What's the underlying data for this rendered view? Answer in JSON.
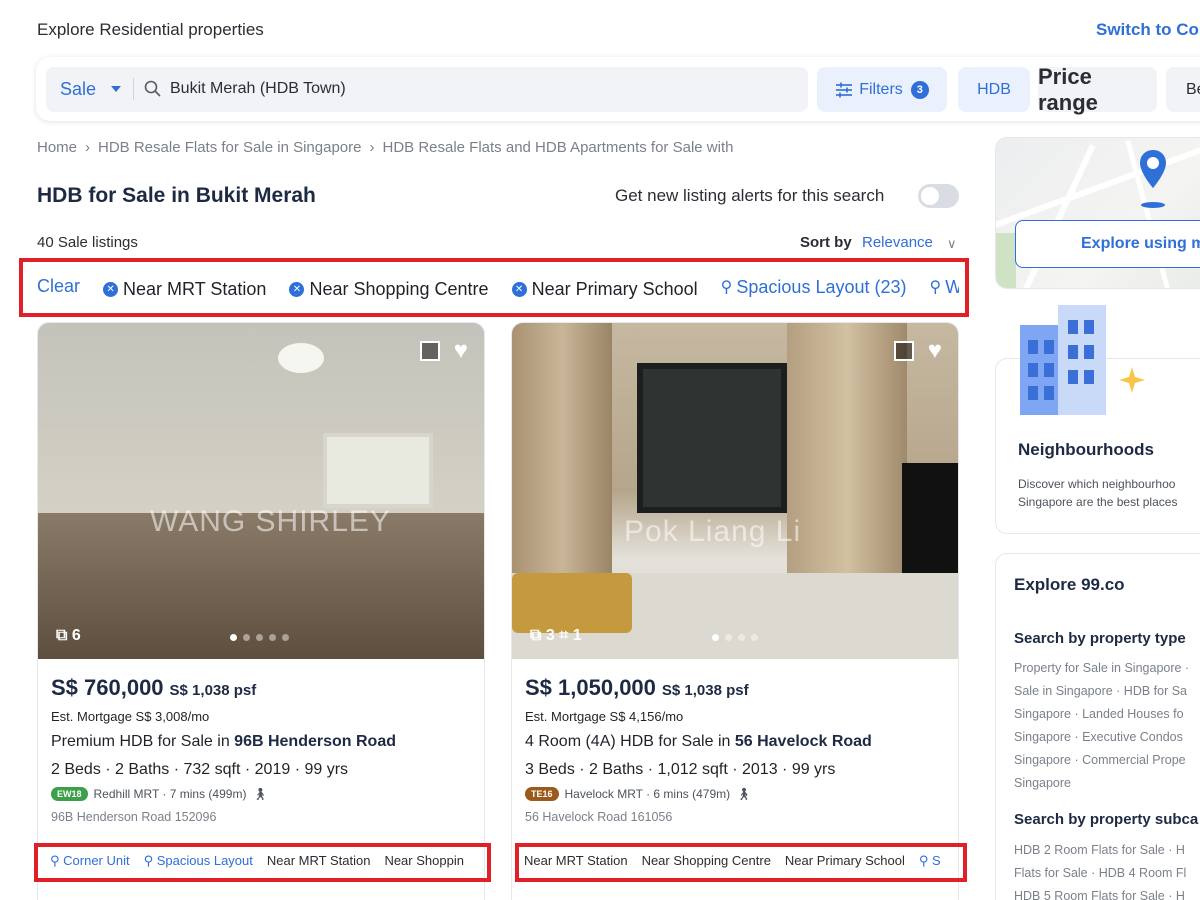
{
  "header": {
    "explore_label": "Explore Residential properties",
    "switch_label": "Switch to Co"
  },
  "search": {
    "mode": "Sale",
    "query": "Bukit Merah (HDB Town)",
    "filters_label": "Filters",
    "filters_count": "3",
    "hdb_label": "HDB",
    "price_label": "Price range",
    "beds_label": "Be"
  },
  "breadcrumb": [
    "Home",
    "HDB Resale Flats for Sale in Singapore",
    "HDB Resale Flats and HDB Apartments for Sale with"
  ],
  "page": {
    "title": "HDB for Sale in Bukit Merah",
    "alert_label": "Get new listing alerts for this search",
    "count_label": "40 Sale listings",
    "sort_label": "Sort by",
    "sort_value": "Relevance"
  },
  "chips": {
    "clear": "Clear",
    "active": [
      "Near MRT Station",
      "Near Shopping Centre",
      "Near Primary School"
    ],
    "suggested": [
      "Spacious Layout (23)",
      "We"
    ]
  },
  "listings": [
    {
      "watermark": "WANG SHIRLEY",
      "photo_count": "6",
      "price": "S$ 760,000",
      "psf": "S$ 1,038 psf",
      "mortgage": "Est. Mortgage S$ 3,008/mo",
      "title_prefix": "Premium HDB for Sale in ",
      "title_bold": "96B Henderson Road",
      "specs": "2 Beds · 2 Baths · 732 sqft · 2019 · 99 yrs",
      "mrt_code": "EW18",
      "mrt_color": "#3aa04a",
      "mrt_text": "Redhill MRT · 7 mins (499m)",
      "address": "96B Henderson Road 152096",
      "tags_link": [
        "Corner Unit",
        "Spacious Layout"
      ],
      "tags": [
        "Near MRT Station",
        "Near Shoppin"
      ]
    },
    {
      "watermark": "Pok Liang Li",
      "photo_count": "3",
      "floorplan_count": "1",
      "price": "S$ 1,050,000",
      "psf": "S$ 1,038 psf",
      "mortgage": "Est. Mortgage S$ 4,156/mo",
      "title_prefix": "4 Room (4A) HDB for Sale in ",
      "title_bold": "56 Havelock Road",
      "specs": "3 Beds · 2 Baths · 1,012 sqft · 2013 · 99 yrs",
      "mrt_code": "TE16",
      "mrt_color": "#9b5a1a",
      "mrt_text": "Havelock MRT · 6 mins (479m)",
      "address": "56 Havelock Road 161056",
      "tags": [
        "Near MRT Station",
        "Near Shopping Centre",
        "Near Primary School"
      ],
      "tags_link": [
        "S"
      ]
    }
  ],
  "sidebar": {
    "map_button": "Explore using m",
    "neighbourhoods_title": "Neighbourhoods",
    "neighbourhoods_desc_1": "Discover which neighbourhoo",
    "neighbourhoods_desc_2": "Singapore are the best places",
    "explore_title": "Explore 99.co",
    "type_heading": "Search by property type",
    "type_links": [
      "Property for Sale in Singapore · ",
      "Sale in Singapore · HDB for Sa",
      "Singapore · Landed Houses fo",
      "Singapore · Executive Condos",
      "Singapore · Commercial Prope",
      "Singapore"
    ],
    "subcat_heading": "Search by property subca",
    "subcat_links": [
      "HDB 2 Room Flats for Sale · H",
      "Flats for Sale · HDB 4 Room Fl",
      "HDB 5 Room Flats for Sale · H"
    ]
  }
}
